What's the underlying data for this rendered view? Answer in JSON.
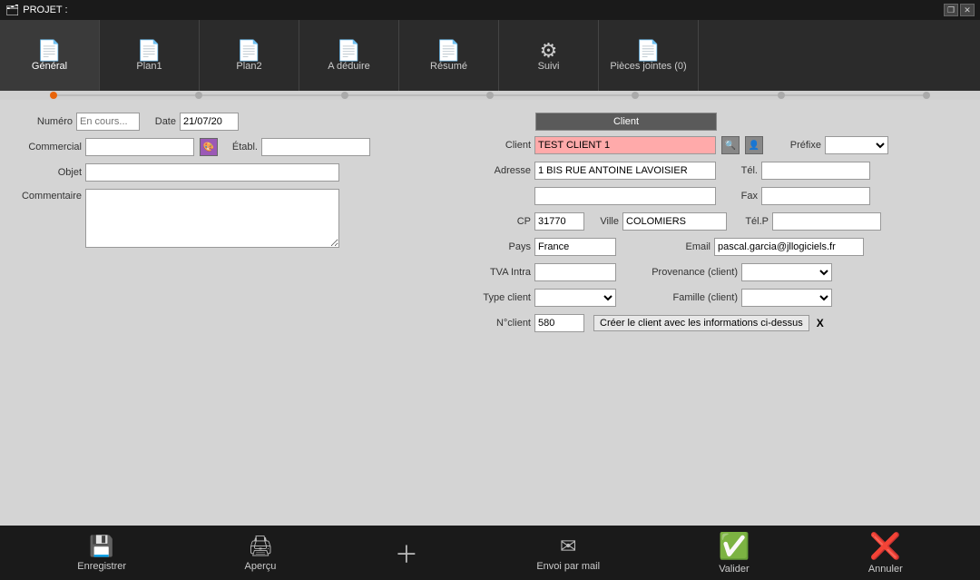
{
  "titlebar": {
    "title": "PROJET :",
    "restore_label": "❐",
    "close_label": "✕"
  },
  "tabs": [
    {
      "label": "Général",
      "active": true
    },
    {
      "label": "Plan1",
      "active": false
    },
    {
      "label": "Plan2",
      "active": false
    },
    {
      "label": "A déduire",
      "active": false
    },
    {
      "label": "Résumé",
      "active": false
    },
    {
      "label": "Suivi",
      "active": false
    },
    {
      "label": "Pièces jointes (0)",
      "active": false
    }
  ],
  "form": {
    "numero_label": "Numéro",
    "numero_value": "En cours...",
    "date_label": "Date",
    "date_value": "21/07/20",
    "commercial_label": "Commercial",
    "etabl_label": "Établ.",
    "objet_label": "Objet",
    "commentaire_label": "Commentaire",
    "client_section_label": "Client",
    "client_label": "Client",
    "client_value": "TEST CLIENT 1",
    "prefixe_label": "Préfixe",
    "adresse_label": "Adresse",
    "adresse_value": "1 BIS RUE ANTOINE LAVOISIER",
    "adresse2_value": "",
    "cp_label": "CP",
    "cp_value": "31770",
    "ville_label": "Ville",
    "ville_value": "COLOMIERS",
    "tel_label": "Tél.",
    "fax_label": "Fax",
    "telp_label": "Tél.P",
    "pays_label": "Pays",
    "pays_value": "France",
    "email_label": "Email",
    "email_value": "pascal.garcia@jllogiciels.fr",
    "tva_intra_label": "TVA Intra",
    "provenance_label": "Provenance (client)",
    "type_client_label": "Type client",
    "famille_label": "Famille (client)",
    "nclient_label": "N°client",
    "nclient_value": "580",
    "creer_client_label": "Créer le client avec les informations ci-dessus",
    "creer_close": "X"
  },
  "bottombar": {
    "enregistrer_label": "Enregistrer",
    "apercu_label": "Aperçu",
    "add_label": "+",
    "envoi_label": "Envoi par mail",
    "valider_label": "Valider",
    "annuler_label": "Annuler"
  }
}
